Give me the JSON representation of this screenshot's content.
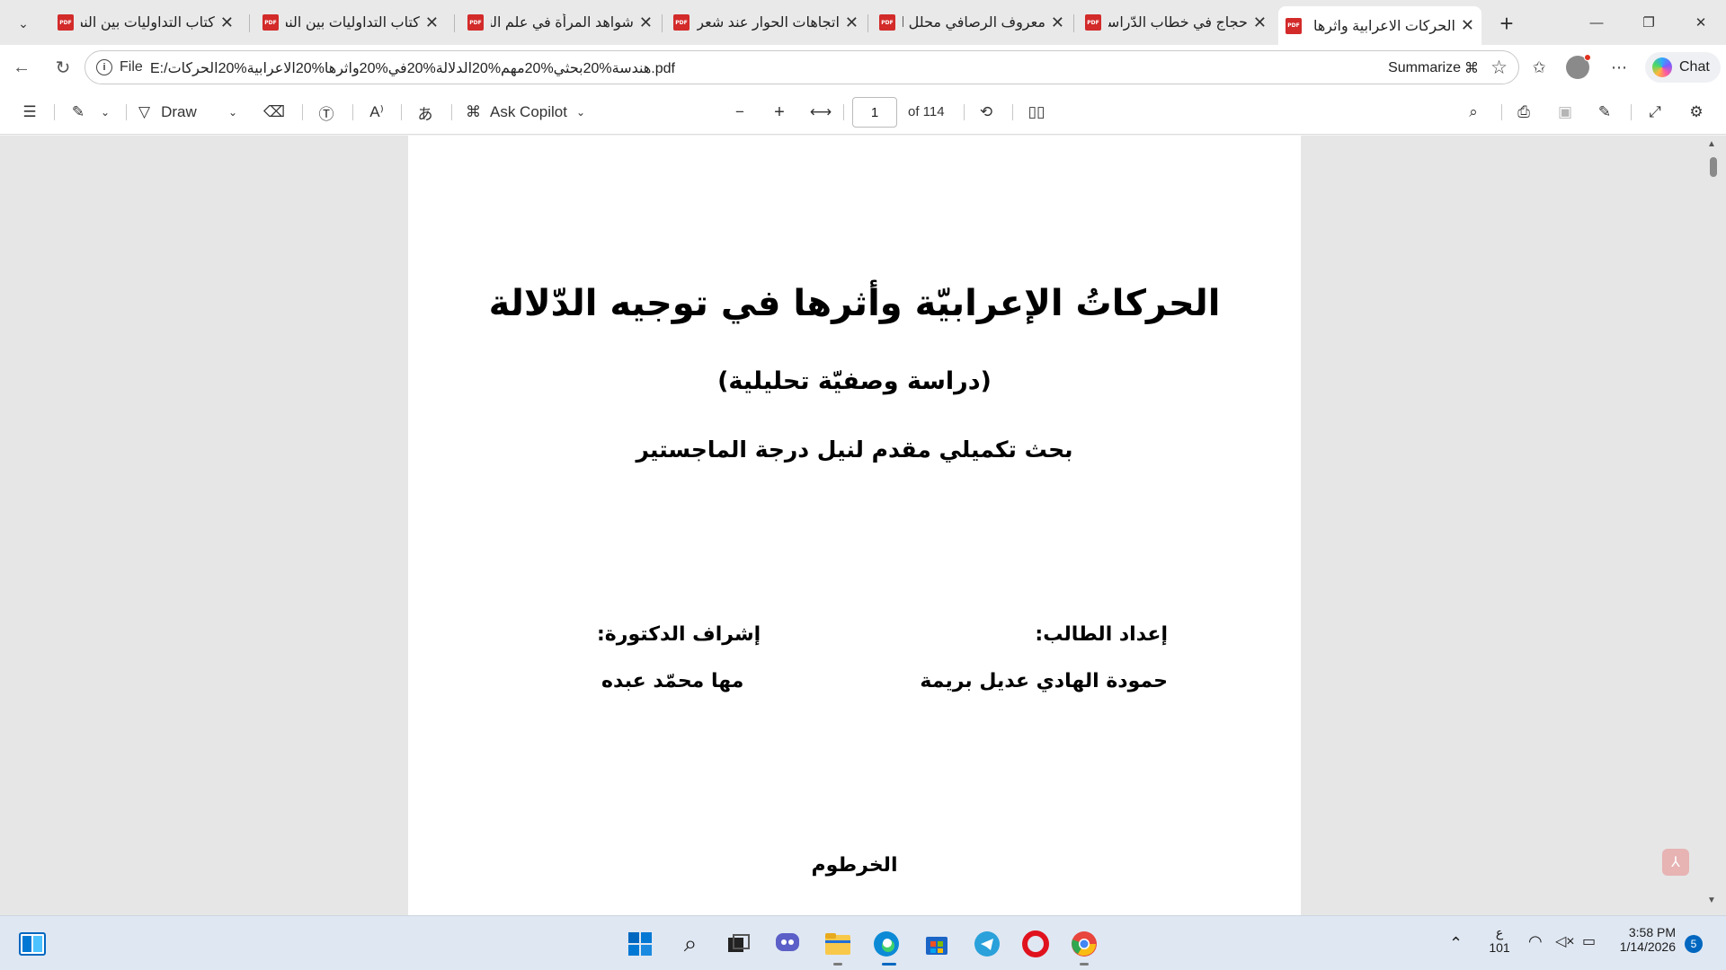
{
  "browser": {
    "tabs": [
      {
        "title": "كتاب التداوليات بين النظر",
        "active": false
      },
      {
        "title": "كتاب التداوليات بين النظر",
        "active": false
      },
      {
        "title": "شواهد المرأة في علم النحو",
        "active": false
      },
      {
        "title": "اتجاهات الحوار عند شعراء",
        "active": false
      },
      {
        "title": "معروف الرصافي محلل اجتماعي",
        "active": false
      },
      {
        "title": "حجاج في خطاب الدّراسات",
        "active": false
      },
      {
        "title": "الحركات الاعرابية واثرها في",
        "active": true
      }
    ],
    "address": {
      "scheme_label": "File",
      "url": "E:/هندسة%20بحثي%20مهم%20الدلالة%20في%20واثرها%20الاعرابية%20الحركات.pdf",
      "summarize_label": "Summarize"
    },
    "chat_label": "Chat"
  },
  "pdf_toolbar": {
    "draw_label": "Draw",
    "copilot_label": "Ask Copilot",
    "page_current": "1",
    "page_total": "of 114"
  },
  "document": {
    "title": "الحركاتُ الإعرابيّة وأثرها في توجيه الدّلالة",
    "subtitle": "(دراسة وصفيّة تحليلية)",
    "degree": "بحث تكميلي مقدم لنيل درجة الماجستير",
    "student_label": "إعداد الطالب:",
    "student_name": "حمودة الهادي عديل بريمة",
    "supervisor_label": "إشراف الدكتورة:",
    "supervisor_name": "مها محمّد عبده",
    "city": "الخرطوم"
  },
  "taskbar": {
    "keyboard_lang": "ع",
    "keyboard_code": "101",
    "time": "3:58 PM",
    "date": "1/14/2026",
    "notification_count": "5"
  },
  "colors": {
    "pdf_icon": "#d32a2a",
    "accent": "#0067c0"
  }
}
